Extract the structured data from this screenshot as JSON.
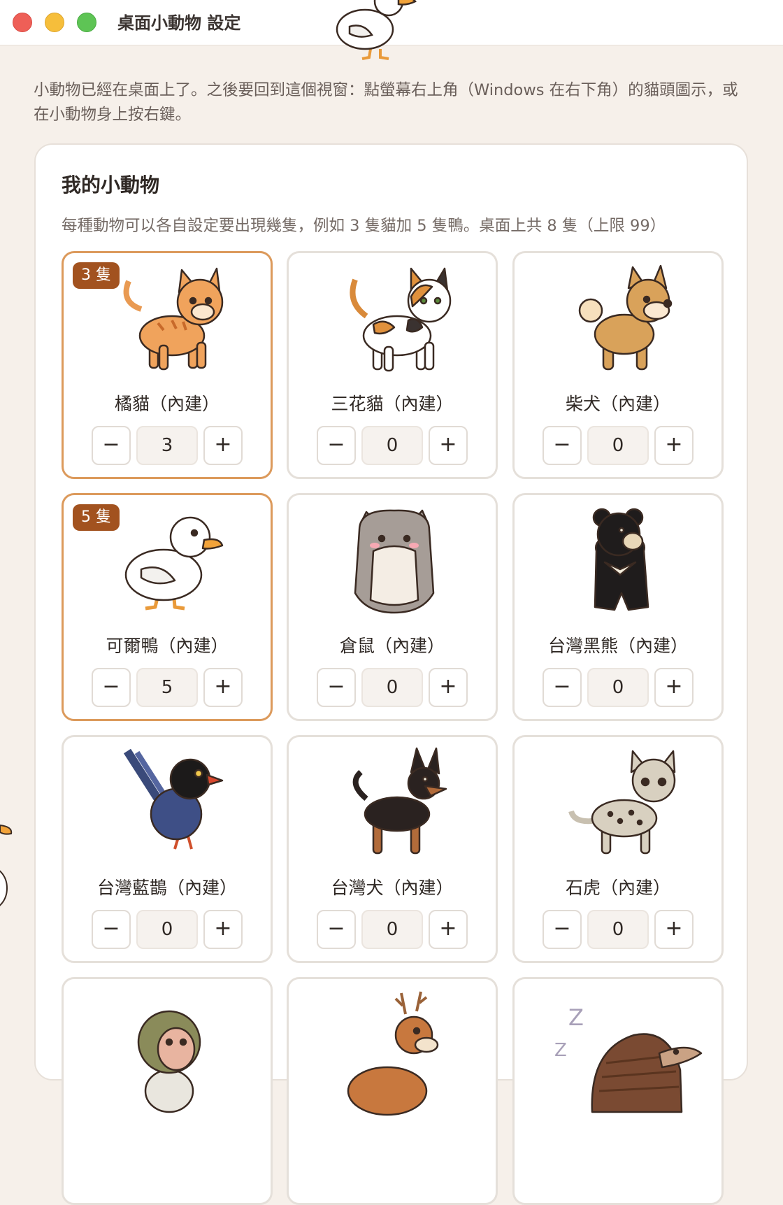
{
  "window": {
    "title": "桌面小動物 設定",
    "controls": [
      "close",
      "minimize",
      "zoom"
    ]
  },
  "intro_text": "小動物已經在桌面上了。之後要回到這個視窗：點螢幕右上角（Windows 在右下角）的貓頭圖示，或在小動物身上按右鍵。",
  "panel": {
    "title": "我的小動物",
    "subtitle": "每種動物可以各自設定要出現幾隻，例如 3 隻貓加 5 隻鴨。桌面上共 8 隻（上限 99）"
  },
  "stepper": {
    "minus": "−",
    "plus": "+"
  },
  "animals": [
    {
      "name": "橘貓（內建）",
      "count": "3",
      "badge": "3 隻",
      "selected": true,
      "icon": "orange-cat-icon"
    },
    {
      "name": "三花貓（內建）",
      "count": "0",
      "badge": "",
      "selected": false,
      "icon": "calico-cat-icon"
    },
    {
      "name": "柴犬（內建）",
      "count": "0",
      "badge": "",
      "selected": false,
      "icon": "shiba-icon"
    },
    {
      "name": "可爾鴨（內建）",
      "count": "5",
      "badge": "5 隻",
      "selected": true,
      "icon": "call-duck-icon"
    },
    {
      "name": "倉鼠（內建）",
      "count": "0",
      "badge": "",
      "selected": false,
      "icon": "hamster-icon"
    },
    {
      "name": "台灣黑熊（內建）",
      "count": "0",
      "badge": "",
      "selected": false,
      "icon": "black-bear-icon"
    },
    {
      "name": "台灣藍鵲（內建）",
      "count": "0",
      "badge": "",
      "selected": false,
      "icon": "blue-magpie-icon"
    },
    {
      "name": "台灣犬（內建）",
      "count": "0",
      "badge": "",
      "selected": false,
      "icon": "taiwan-dog-icon"
    },
    {
      "name": "石虎（內建）",
      "count": "0",
      "badge": "",
      "selected": false,
      "icon": "leopard-cat-icon"
    },
    {
      "name": "",
      "count": "",
      "badge": "",
      "selected": false,
      "icon": "macaque-icon"
    },
    {
      "name": "",
      "count": "",
      "badge": "",
      "selected": false,
      "icon": "deer-icon"
    },
    {
      "name": "",
      "count": "",
      "badge": "",
      "selected": false,
      "icon": "pangolin-icon"
    }
  ],
  "colors": {
    "background": "#f6f0ea",
    "selected_border": "#dc9a5c",
    "badge": "#a2521f"
  }
}
